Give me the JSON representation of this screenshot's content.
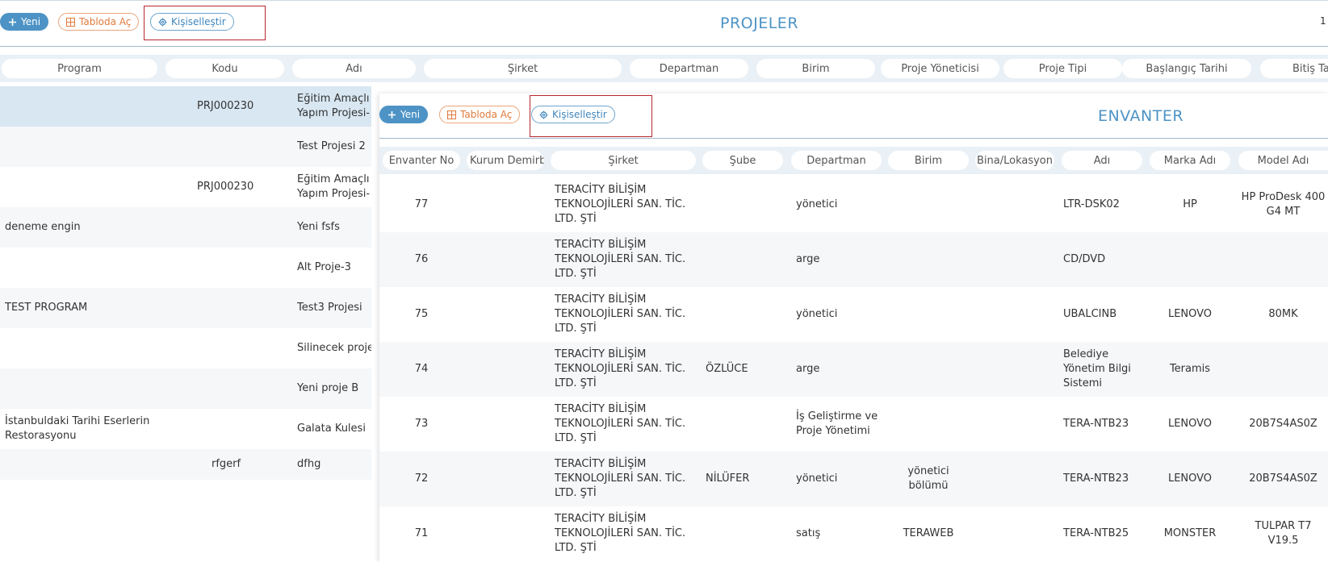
{
  "projeler": {
    "toolbar": {
      "new_label": "Yeni",
      "table_label": "Tabloda Aç",
      "customize_label": "Kişiselleştir"
    },
    "title": "PROJELER",
    "page_indicator": "1",
    "columns": [
      "Program",
      "Kodu",
      "Adı",
      "Şirket",
      "Departman",
      "Birim",
      "Proje Yöneticisi",
      "Proje Tipi",
      "Başlangıç Tarihi",
      "Bitiş Ta"
    ],
    "rows": [
      {
        "program": "",
        "kodu": "PRJ000230",
        "adi_1": "Eğitim Amaçlı",
        "adi_2": "Yapım Projesi-"
      },
      {
        "program": "",
        "kodu": "",
        "adi_1": "Test Projesi 2",
        "adi_2": ""
      },
      {
        "program": "",
        "kodu": "PRJ000230",
        "adi_1": "Eğitim Amaçlı",
        "adi_2": "Yapım Projesi-"
      },
      {
        "program": "deneme engin",
        "kodu": "",
        "adi_1": "Yeni fsfs",
        "adi_2": ""
      },
      {
        "program": "",
        "kodu": "",
        "adi_1": "Alt Proje-3",
        "adi_2": ""
      },
      {
        "program": "TEST PROGRAM",
        "kodu": "",
        "adi_1": "Test3 Projesi",
        "adi_2": ""
      },
      {
        "program": "",
        "kodu": "",
        "adi_1": "Silinecek proje",
        "adi_2": ""
      },
      {
        "program": "",
        "kodu": "",
        "adi_1": "Yeni proje B",
        "adi_2": ""
      },
      {
        "program": "İstanbuldaki Tarihi Eserlerin Restorasyonu",
        "kodu": "",
        "adi_1": "Galata Kulesi",
        "adi_2": ""
      },
      {
        "program": "",
        "kodu": "rfgerf",
        "adi_1": "dfhg",
        "adi_2": ""
      }
    ]
  },
  "envanter": {
    "toolbar": {
      "new_label": "Yeni",
      "table_label": "Tabloda Aç",
      "customize_label": "Kişiselleştir"
    },
    "title": "ENVANTER",
    "columns": [
      "Envanter No",
      "Kurum Demirbaş",
      "Şirket",
      "Şube",
      "Departman",
      "Birim",
      "Bina/Lokasyon",
      "Adı",
      "Marka Adı",
      "Model Adı"
    ],
    "rows": [
      {
        "no": "77",
        "kurum": "",
        "sirket": "TERACİTY BİLİŞİM TEKNOLOJİLERİ SAN. TİC. LTD. ŞTİ",
        "sube": "",
        "departman": "yönetici",
        "birim": "",
        "bina": "",
        "adi": "LTR-DSK02",
        "marka": "HP",
        "model": "HP ProDesk 400 G4 MT"
      },
      {
        "no": "76",
        "kurum": "",
        "sirket": "TERACİTY BİLİŞİM TEKNOLOJİLERİ SAN. TİC. LTD. ŞTİ",
        "sube": "",
        "departman": "arge",
        "birim": "",
        "bina": "",
        "adi": "CD/DVD",
        "marka": "",
        "model": ""
      },
      {
        "no": "75",
        "kurum": "",
        "sirket": "TERACİTY BİLİŞİM TEKNOLOJİLERİ SAN. TİC. LTD. ŞTİ",
        "sube": "",
        "departman": "yönetici",
        "birim": "",
        "bina": "",
        "adi": "UBALCINB",
        "marka": "LENOVO",
        "model": "80MK"
      },
      {
        "no": "74",
        "kurum": "",
        "sirket": "TERACİTY BİLİŞİM TEKNOLOJİLERİ SAN. TİC. LTD. ŞTİ",
        "sube": "ÖZLÜCE",
        "departman": "arge",
        "birim": "",
        "bina": "",
        "adi": "Belediye Yönetim Bilgi Sistemi",
        "marka": "Teramis",
        "model": ""
      },
      {
        "no": "73",
        "kurum": "",
        "sirket": "TERACİTY BİLİŞİM TEKNOLOJİLERİ SAN. TİC. LTD. ŞTİ",
        "sube": "",
        "departman": "İş Geliştirme ve Proje Yönetimi",
        "birim": "",
        "bina": "",
        "adi": "TERA-NTB23",
        "marka": "LENOVO",
        "model": "20B7S4AS0Z"
      },
      {
        "no": "72",
        "kurum": "",
        "sirket": "TERACİTY BİLİŞİM TEKNOLOJİLERİ SAN. TİC. LTD. ŞTİ",
        "sube": "NİLÜFER",
        "departman": "yönetici",
        "birim": "yönetici bölümü",
        "bina": "",
        "adi": "TERA-NTB23",
        "marka": "LENOVO",
        "model": "20B7S4AS0Z"
      },
      {
        "no": "71",
        "kurum": "",
        "sirket": "TERACİTY BİLİŞİM TEKNOLOJİLERİ SAN. TİC. LTD. ŞTİ",
        "sube": "",
        "departman": "satış",
        "birim": "TERAWEB",
        "bina": "",
        "adi": "TERA-NTB25",
        "marka": "MONSTER",
        "model": "TULPAR T7 V19.5"
      }
    ]
  }
}
